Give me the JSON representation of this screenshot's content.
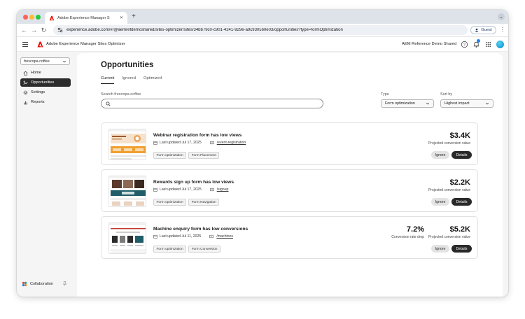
{
  "browser": {
    "tab_title": "Adobe Experience Manager S",
    "url": "experience.adobe.com/#/@aemrefdemoshared/sites-optimizer/sites/34bb79c0-c901-4241-929e-a9c930560e03/opportunities?type=formOptimization",
    "guest_label": "Guest"
  },
  "app": {
    "title": "Adobe Experience Manager Sites Optimizer",
    "org_name": "AEM Reference Demo Shared"
  },
  "sidebar": {
    "site_select": "frescopa.coffee",
    "items": [
      {
        "label": "Home",
        "icon": "home-icon"
      },
      {
        "label": "Opportunities",
        "icon": "opportunities-icon"
      },
      {
        "label": "Settings",
        "icon": "gear-icon"
      },
      {
        "label": "Reports",
        "icon": "reports-icon"
      }
    ],
    "active": "Opportunities",
    "collaboration": "Collaboration"
  },
  "main": {
    "title": "Opportunities",
    "tabs": [
      {
        "label": "Current"
      },
      {
        "label": "Ignored"
      },
      {
        "label": "Optimized"
      }
    ],
    "active_tab": "Current",
    "search_label": "Search frescopa.coffee",
    "search_placeholder": "",
    "type_label": "Type",
    "type_value": "Form optimization",
    "sort_label": "Sort by",
    "sort_value": "Highest impact",
    "ignore_label": "Ignore",
    "details_label": "Details"
  },
  "cards": [
    {
      "title": "Webinar registration form has low views",
      "updated": "Last updated Jul 17, 2025",
      "path": "/event-registration",
      "tags": [
        "Form optimization",
        "Form Placement"
      ],
      "value": "$3.4K",
      "value_label": "Projected conversion value"
    },
    {
      "title": "Rewards sign up form has low views",
      "updated": "Last updated Jul 17, 2025",
      "path": "/signup",
      "tags": [
        "Form optimization",
        "Form Navigation"
      ],
      "value": "$2.2K",
      "value_label": "Projected conversion value"
    },
    {
      "title": "Machine enquiry form has low conversions",
      "updated": "Last updated Jul 11, 2025",
      "path": "/machines",
      "tags": [
        "Form optimization",
        "Form Conversion"
      ],
      "value": "$5.2K",
      "value_label": "Projected conversion value",
      "secondary_value": "7.2%",
      "secondary_label": "Conversion rate drop"
    }
  ],
  "colors": {
    "adobe_red": "#eb1000",
    "active_nav": "#2c2c2c",
    "details_button": "#292929",
    "accent_blue": "#2680eb"
  }
}
